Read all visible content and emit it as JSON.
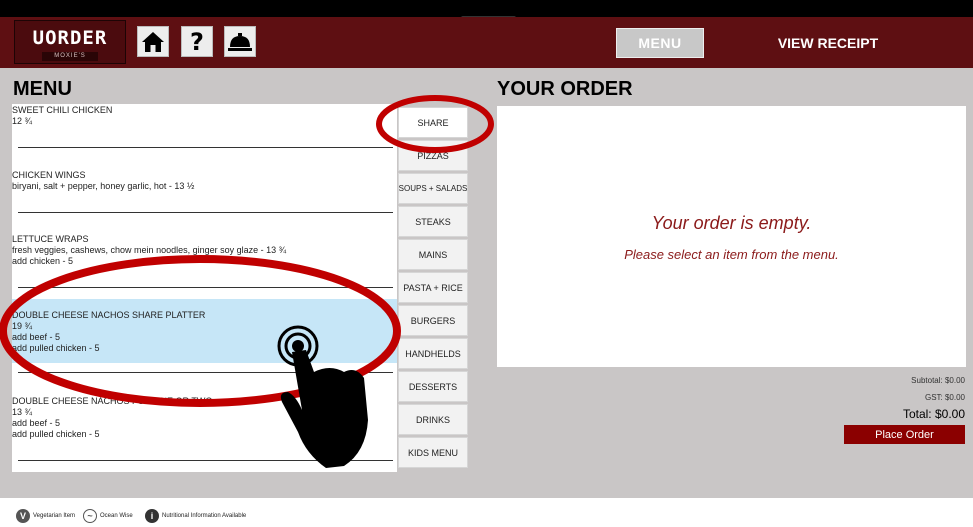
{
  "header": {
    "logo": "UORDER",
    "logo_sub": "MOXIE'S",
    "menu_tab": "MENU",
    "receipt_tab": "VIEW RECEIPT"
  },
  "menu": {
    "title": "MENU",
    "items": [
      {
        "name": "SWEET CHILI CHICKEN",
        "lines": [
          "12 ¾"
        ]
      },
      {
        "name": "CHICKEN WINGS",
        "lines": [
          "biryani, salt + pepper, honey garlic, hot - 13 ½"
        ]
      },
      {
        "name": "LETTUCE WRAPS",
        "lines": [
          "fresh veggies, cashews, chow mein noodles, ginger soy glaze - 13 ¾",
          "add chicken - 5"
        ]
      },
      {
        "name": "DOUBLE CHEESE NACHOS SHARE PLATTER",
        "lines": [
          "19 ¾",
          "add beef - 5",
          "add pulled chicken - 5"
        ],
        "selected": true
      },
      {
        "name": "DOUBLE CHEESE NACHOS FOR ONE OR TWO",
        "lines": [
          "13 ¾",
          "add beef - 5",
          "add pulled chicken - 5"
        ]
      }
    ]
  },
  "categories": [
    "SHARE",
    "PIZZAS",
    "SOUPS + SALADS",
    "STEAKS",
    "MAINS",
    "PASTA + RICE",
    "BURGERS",
    "HANDHELDS",
    "DESSERTS",
    "DRINKS",
    "KIDS MENU"
  ],
  "order": {
    "title": "YOUR ORDER",
    "empty_title": "Your order is empty.",
    "empty_hint": "Please select an item from the menu.",
    "subtotal": "Subtotal: $0.00",
    "gst": "GST: $0.00",
    "total": "Total: $0.00",
    "place_order": "Place Order"
  },
  "legend": {
    "vegetarian": "Vegetarian Item",
    "ocean_wise": "Ocean Wise",
    "nutrition": "Nutritional Information Available"
  },
  "colors": {
    "header": "#5e0f12",
    "accent": "#8b0000",
    "selected_item": "#c6e6f7",
    "annotation": "#c00000"
  }
}
